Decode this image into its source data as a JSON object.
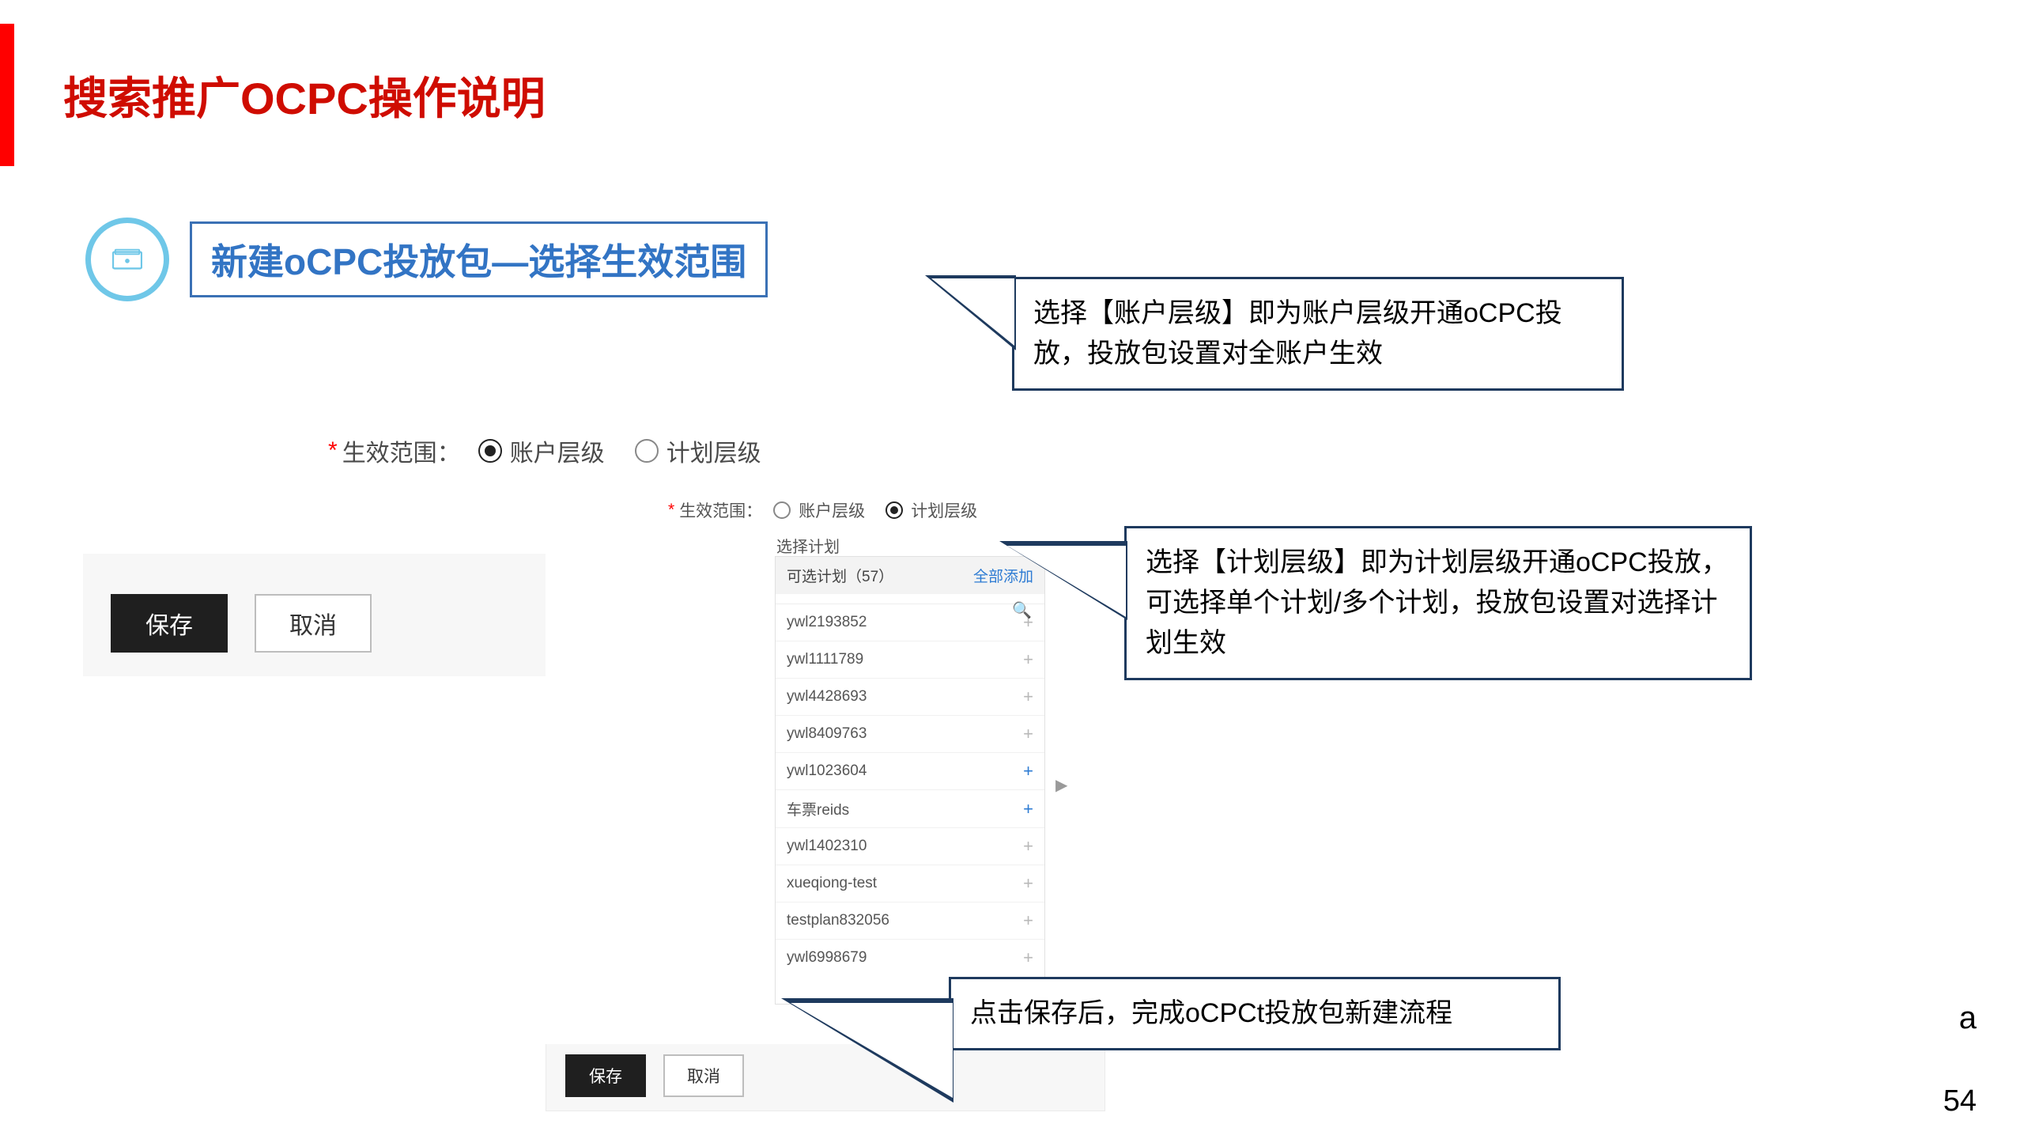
{
  "colors": {
    "accent_red": "#cf0c00",
    "accent_blue": "#3274c4",
    "callout_border": "#1e3a5e",
    "icon_ring": "#6fc7e8"
  },
  "title": "搜索推广OCPC操作说明",
  "subtitle": "新建oCPC投放包—选择生效范围",
  "form": {
    "scope_label": "生效范围：",
    "required_mark": "*",
    "radio_account": "账户层级",
    "radio_plan": "计划层级",
    "save": "保存",
    "cancel": "取消"
  },
  "plan_picker": {
    "choose_label": "选择计划",
    "available_label": "可选计划（57）",
    "add_all": "全部添加",
    "items": [
      {
        "name": "ywl2193852",
        "active": false
      },
      {
        "name": "ywl1111789",
        "active": false
      },
      {
        "name": "ywl4428693",
        "active": false
      },
      {
        "name": "ywl8409763",
        "active": false
      },
      {
        "name": "ywl1023604",
        "active": true
      },
      {
        "name": "车票reids",
        "active": true
      },
      {
        "name": "ywl1402310",
        "active": false
      },
      {
        "name": "xueqiong-test",
        "active": false
      },
      {
        "name": "testplan832056",
        "active": false
      },
      {
        "name": "ywl6998679",
        "active": false
      }
    ]
  },
  "callouts": {
    "account": "选择【账户层级】即为账户层级开通oCPC投放，投放包设置对全账户生效",
    "plan": "选择【计划层级】即为计划层级开通oCPC投放，可选择单个计划/多个计划，投放包设置对选择计划生效",
    "save": "点击保存后，完成oCPCt投放包新建流程"
  },
  "page_number": "54",
  "stray": "a"
}
